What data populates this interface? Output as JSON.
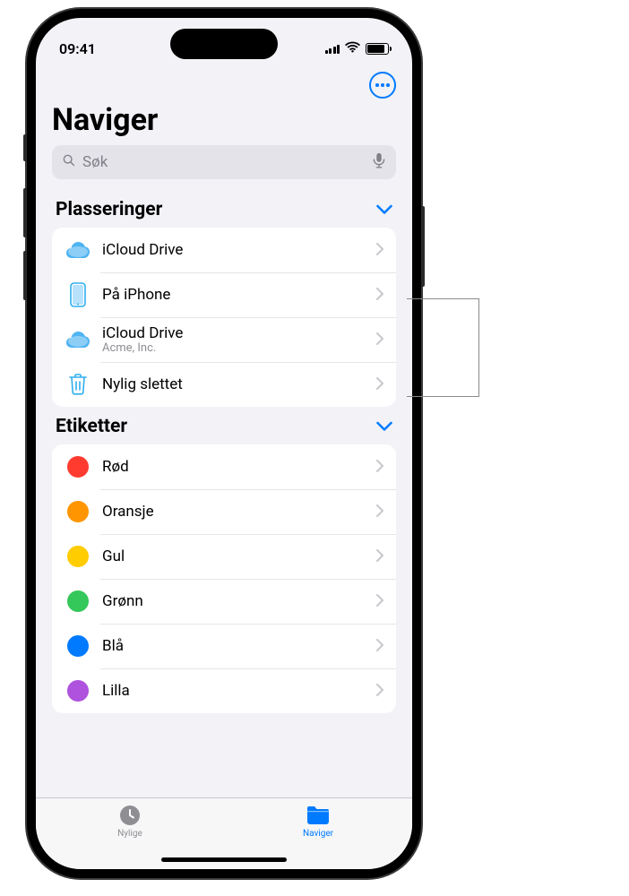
{
  "status_bar": {
    "time": "09:41"
  },
  "header": {
    "title": "Naviger"
  },
  "search": {
    "placeholder": "Søk"
  },
  "sections": {
    "locations": {
      "title": "Plasseringer",
      "items": [
        {
          "icon": "icloud",
          "label": "iCloud Drive",
          "sublabel": ""
        },
        {
          "icon": "iphone",
          "label": "På iPhone",
          "sublabel": ""
        },
        {
          "icon": "icloud",
          "label": "iCloud Drive",
          "sublabel": "Acme, Inc."
        },
        {
          "icon": "trash",
          "label": "Nylig slettet",
          "sublabel": ""
        }
      ]
    },
    "tags": {
      "title": "Etiketter",
      "items": [
        {
          "color": "#ff3b30",
          "label": "Rød"
        },
        {
          "color": "#ff9500",
          "label": "Oransje"
        },
        {
          "color": "#ffcc00",
          "label": "Gul"
        },
        {
          "color": "#34c759",
          "label": "Grønn"
        },
        {
          "color": "#007aff",
          "label": "Blå"
        },
        {
          "color": "#af52de",
          "label": "Lilla"
        }
      ]
    }
  },
  "tabs": {
    "recents": "Nylige",
    "browse": "Naviger"
  }
}
